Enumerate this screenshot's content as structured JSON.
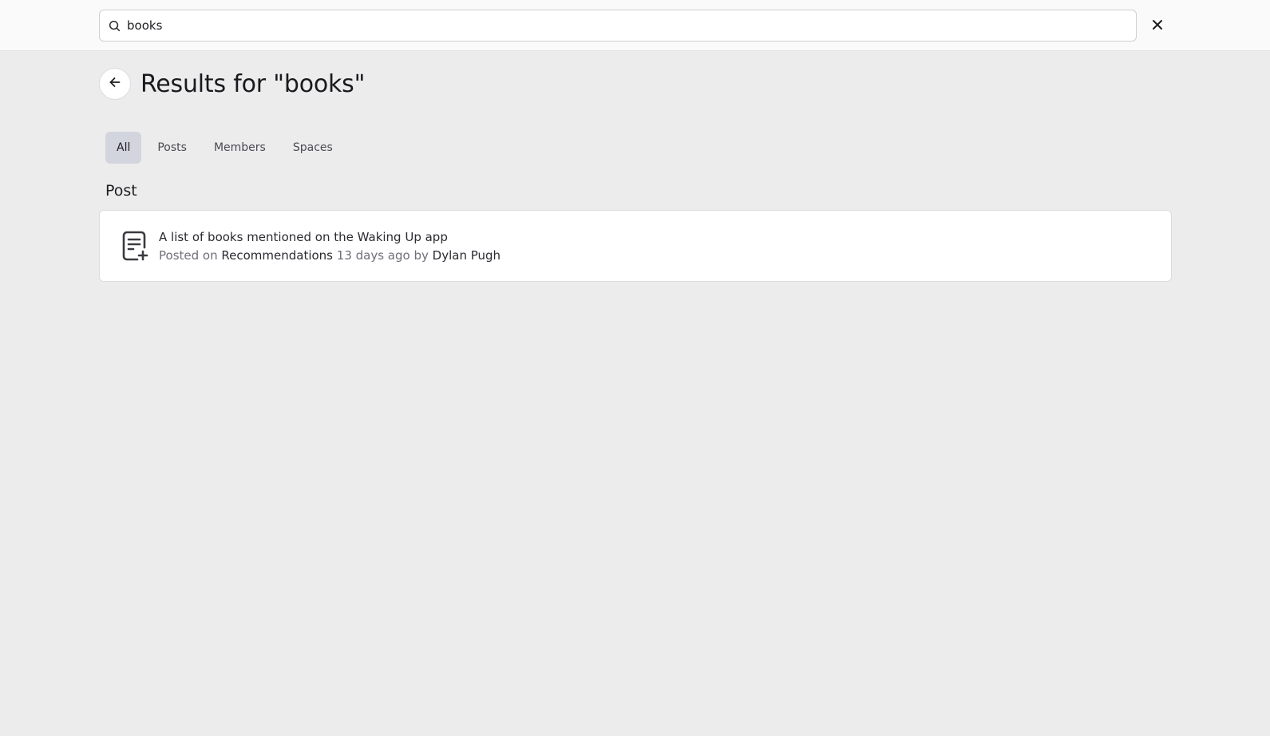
{
  "search": {
    "value": "books",
    "icon": "search-icon"
  },
  "close_icon": "close-icon",
  "header": {
    "back_icon": "arrow-left-icon",
    "title": "Results for \"books\""
  },
  "tabs": [
    {
      "label": "All",
      "active": true
    },
    {
      "label": "Posts",
      "active": false
    },
    {
      "label": "Members",
      "active": false
    },
    {
      "label": "Spaces",
      "active": false
    }
  ],
  "section": {
    "title": "Post"
  },
  "results": [
    {
      "icon": "document-add-icon",
      "title": "A list of books mentioned on the Waking Up app",
      "posted_on_label": "Posted on",
      "space": "Recommendations",
      "time_label": "13 days ago by",
      "author": "Dylan Pugh"
    }
  ],
  "colors": {
    "background": "#ececed",
    "active_tab": "#d3d5de",
    "card": "#ffffff"
  }
}
